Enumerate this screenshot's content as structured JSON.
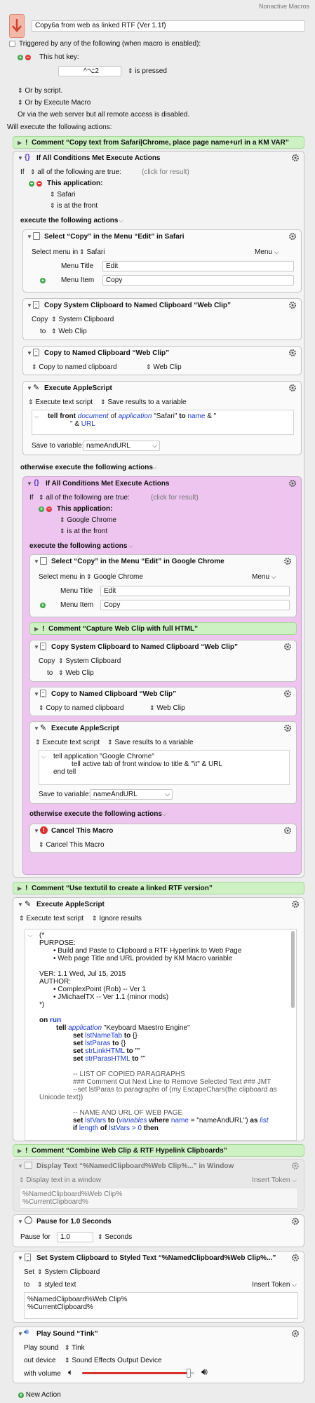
{
  "corner_label": "Nonactive Macros",
  "macro_title": "Copy6a from web as linked RTF (Ver 1.1f)",
  "trigger": {
    "header": "Triggered by any of the following (when macro is enabled):",
    "hotkey_label": "This hot key:",
    "hotkey_value": "^⌥2",
    "hotkey_mode": "is pressed",
    "by_script": "Or by script.",
    "by_execute": "Or by Execute Macro",
    "by_web": "Or via the web server but all remote access is disabled."
  },
  "will_execute": "Will execute the following actions:",
  "comment1": "Comment “Copy text from Safari|Chrome, place page name+url in a KM VAR”",
  "if1": {
    "title": "If All Conditions Met Execute Actions",
    "if_prefix": "If",
    "condition_mode": "all of the following are true:",
    "click_hint": "(click for result)",
    "condition_label": "This application:",
    "app": "Safari",
    "app_state": "is at the front",
    "then_label": "execute the following actions",
    "else_label": "otherwise execute the following actions",
    "select_menu": {
      "title": "Select “Copy” in the Menu “Edit” in Safari",
      "select_in": "Select menu in",
      "app": "Safari",
      "menu_dd": "Menu",
      "menu_title_label": "Menu Title",
      "menu_title": "Edit",
      "menu_item_label": "Menu Item",
      "menu_item": "Copy"
    },
    "copy_named": {
      "title": "Copy System Clipboard to Named Clipboard “Web Clip”",
      "copy_label": "Copy",
      "copy_src": "System Clipboard",
      "to_label": "to",
      "dest": "Web Clip"
    },
    "copy_to_named": {
      "title": "Copy to Named Clipboard “Web Clip”",
      "mode": "Copy to named clipboard",
      "dest": "Web Clip"
    },
    "applescript": {
      "title": "Execute AppleScript",
      "mode": "Execute text script",
      "save": "Save results to a variable",
      "code1a": "tell front ",
      "code1b": "document",
      "code1c": " of ",
      "code1d": "application",
      "code1e": " \"Safari\" ",
      "code1f": "to",
      "code1g": " ",
      "code1h": "name",
      "code1i": " & \"",
      "code2a": "\" & ",
      "code2b": "URL",
      "save_label": "Save to variable:",
      "var": "nameAndURL"
    }
  },
  "if2": {
    "title": "If All Conditions Met Execute Actions",
    "if_prefix": "If",
    "condition_mode": "all of the following are true:",
    "click_hint": "(click for result)",
    "condition_label": "This application:",
    "app": "Google Chrome",
    "app_state": "is at the front",
    "then_label": "execute the following actions",
    "else_label": "otherwise execute the following actions",
    "select_menu": {
      "title": "Select “Copy” in the Menu “Edit” in Google Chrome",
      "select_in": "Select menu in",
      "app": "Google Chrome",
      "menu_dd": "Menu",
      "menu_title_label": "Menu Title",
      "menu_title": "Edit",
      "menu_item_label": "Menu Item",
      "menu_item": "Copy"
    },
    "comment": "Comment “Capture Web Clip with full HTML”",
    "copy_named": {
      "title": "Copy System Clipboard to Named Clipboard “Web Clip”",
      "copy_label": "Copy",
      "copy_src": "System Clipboard",
      "to_label": "to",
      "dest": "Web Clip"
    },
    "copy_to_named": {
      "title": "Copy to Named Clipboard “Web Clip”",
      "mode": "Copy to named clipboard",
      "dest": "Web Clip"
    },
    "applescript": {
      "title": "Execute AppleScript",
      "mode": "Execute text script",
      "save": "Save results to a variable",
      "l1": "tell application \"Google Chrome\"",
      "l2": "tell active tab of front window to title & \"\\t\" & URL",
      "l3": "end tell",
      "save_label": "Save to variable:",
      "var": "nameAndURL"
    },
    "cancel": {
      "title": "Cancel This Macro",
      "mode": "Cancel This Macro"
    }
  },
  "comment2": "Comment “Use textutil to create a linked RTF version”",
  "applescript_main": {
    "title": "Execute AppleScript",
    "mode": "Execute text script",
    "ignore": "Ignore results",
    "lines": {
      "l01": "(*",
      "l02": "PURPOSE:",
      "l03": "Build and Paste to Clipboard a RTF Hyperlink to Web Page",
      "l04": "Web page Title and URL provided by KM Macro variable",
      "l05": "VER:  1.1   Wed, Jul 15, 2015",
      "l06": "AUTHOR:",
      "l07": "ComplexPoint (Rob) -- Ver 1",
      "l08": "JMichaelTX -- Ver 1.1 (minor mods)",
      "l09": "*)",
      "l10a": "on",
      "l10b": "run",
      "l11a": "tell",
      "l11b": "application",
      "l11c": " \"Keyboard Maestro Engine\"",
      "l12a": "set",
      "l12b": "lstNameTab",
      "l12c": "to",
      "l12d": " {}",
      "l13a": "set",
      "l13b": "lstParas",
      "l13c": "to",
      "l13d": " {}",
      "l14a": "set",
      "l14b": "strLinkHTML",
      "l14c": "to",
      "l14d": " \"\"",
      "l15a": "set",
      "l15b": "strParasHTML",
      "l15c": "to",
      "l15d": " \"\"",
      "l16": "-- LIST OF COPIED PARAGRAPHS",
      "l17": "### Comment Out Next Line to Remove Selected Text ###   JMT",
      "l18": "--set lstParas to paragraphs of (my EscapeChars(the clipboard as",
      "l19": "Unicode text))",
      "l20": "-- NAME AND URL OF WEB PAGE",
      "l21a": "set",
      "l21b": "lstVars",
      "l21c": "to",
      "l21d": " (",
      "l21e": "variables",
      "l21f": " where ",
      "l21g": "name",
      "l21h": " = \"nameAndURL\") ",
      "l21i": "as",
      "l21j": " list",
      "l22a": "if",
      "l22b": " length ",
      "l22c": "of",
      "l22d": " lstVars > 0 ",
      "l22e": "then"
    }
  },
  "comment3": "Comment “Combine Web Clip & RTF Hypelink Clipboards”",
  "display": {
    "title": "Display Text “%NamedClipboard%Web Clip%...” in Window",
    "mode": "Display text in a window",
    "insert": "Insert Token",
    "l1": "%NamedClipboard%Web Clip%",
    "l2": "%CurrentClipboard%"
  },
  "pause": {
    "title": "Pause for 1.0 Seconds",
    "label": "Pause for",
    "value": "1.0",
    "unit": "Seconds"
  },
  "set_clip": {
    "title": "Set System Clipboard to Styled Text “%NamedClipboard%Web Clip%...”",
    "set_label": "Set",
    "target": "System Clipboard",
    "to_label": "to",
    "kind": "styled text",
    "insert": "Insert Token",
    "l1": "%NamedClipboard%Web Clip%",
    "l2": "%CurrentClipboard%"
  },
  "sound": {
    "title": "Play Sound “Tink”",
    "play_label": "Play sound",
    "sound": "Tink",
    "out_label": "out device",
    "device": "Sound Effects Output Device",
    "vol_label": "with volume",
    "volume": 0.95
  },
  "new_action": "New Action"
}
